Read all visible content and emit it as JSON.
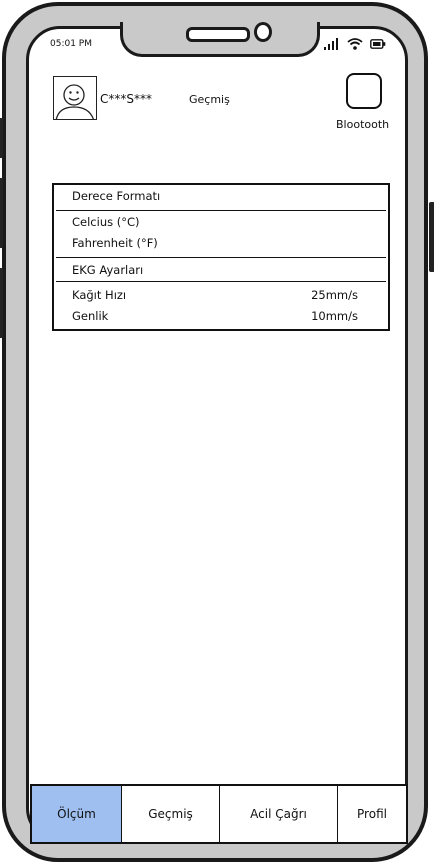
{
  "status_bar": {
    "time": "05:01 PM"
  },
  "header": {
    "user_name": "C***S***",
    "history_link": "Geçmiş",
    "bluetooth_label": "Blootooth"
  },
  "settings": {
    "degree_section_title": "Derece Formatı",
    "celsius_label": "Celcius (°C)",
    "fahrenheit_label": "Fahrenheit (°F)",
    "ekg_section_title": "EKG Ayarları",
    "paper_speed_label": "Kağıt Hızı",
    "paper_speed_value": "25mm/s",
    "amplitude_label": "Genlik",
    "amplitude_value": "10mm/s"
  },
  "bottom_nav": {
    "items": [
      {
        "label": "Ölçüm",
        "active": true
      },
      {
        "label": "Geçmiş",
        "active": false
      },
      {
        "label": "Acil Çağrı",
        "active": false
      },
      {
        "label": "Profil",
        "active": false
      }
    ]
  },
  "colors": {
    "active_tab": "#9ebff0",
    "frame": "#c9c9c9",
    "ink": "#111111"
  },
  "icons": [
    "avatar-face-icon",
    "signal-icon",
    "wifi-icon",
    "battery-icon"
  ]
}
